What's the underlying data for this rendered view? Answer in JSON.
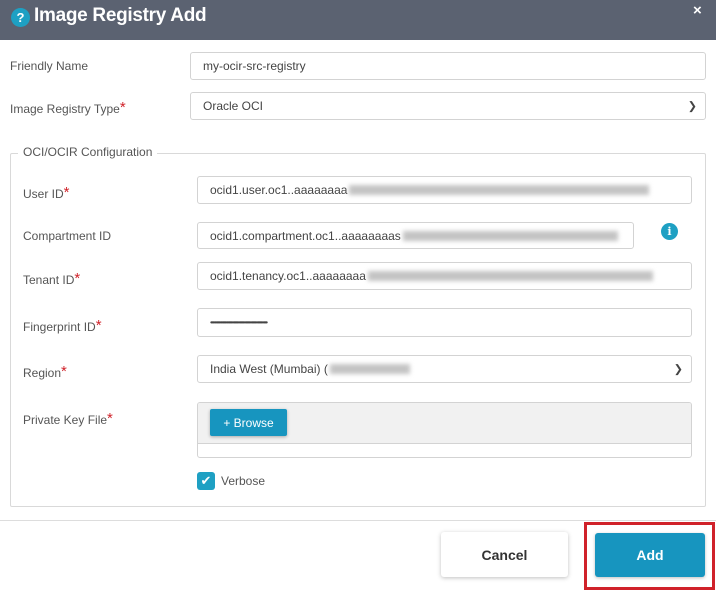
{
  "dialog": {
    "title": "Image Registry Add",
    "help_icon": "question-circle-icon",
    "close_icon": "close-icon",
    "close_glyph": "×"
  },
  "form": {
    "friendly_name": {
      "label": "Friendly Name",
      "value": "my-ocir-src-registry"
    },
    "registry_type": {
      "label": "Image Registry Type",
      "value": "Oracle OCI",
      "required": "*"
    },
    "oci_section": {
      "legend": "OCI/OCIR Configuration"
    },
    "user_id": {
      "label": "User ID",
      "value": "ocid1.user.oc1..aaaaaaaa",
      "required": "*"
    },
    "compartment_id": {
      "label": "Compartment ID",
      "value": "ocid1.compartment.oc1..aaaaaaaas"
    },
    "tenant_id": {
      "label": "Tenant ID",
      "value": "ocid1.tenancy.oc1..aaaaaaaa",
      "required": "*"
    },
    "fingerprint_id": {
      "label": "Fingerprint ID",
      "value": "•••••••••••••••••••••••••••••••••••••••••••••••",
      "required": "*"
    },
    "region": {
      "label": "Region",
      "value": "India West (Mumbai) (",
      "required": "*"
    },
    "private_key": {
      "label": "Private Key File",
      "browse_label": "+ Browse",
      "required": "*"
    },
    "verbose": {
      "label": "Verbose",
      "checked": true
    }
  },
  "footer": {
    "cancel_label": "Cancel",
    "add_label": "Add"
  },
  "colors": {
    "header": "#5b6271",
    "accent": "#1795bf",
    "highlight": "#d0222a"
  }
}
